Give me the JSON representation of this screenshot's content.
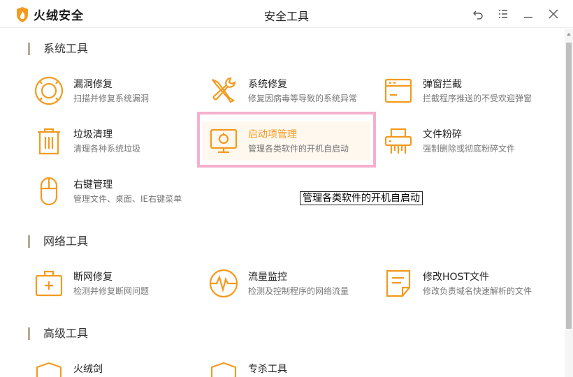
{
  "app": {
    "brand": "火绒安全",
    "window_title": "安全工具"
  },
  "sections": [
    {
      "title": "系统工具",
      "tools": [
        {
          "name": "漏洞修复",
          "desc": "扫描并修复系统漏洞",
          "icon": "lifebuoy-icon"
        },
        {
          "name": "系统修复",
          "desc": "修复因病毒等导致的系统异常",
          "icon": "wrench-screwdriver-icon"
        },
        {
          "name": "弹窗拦截",
          "desc": "拦截程序推送的不受欢迎弹窗",
          "icon": "popup-window-icon"
        },
        {
          "name": "垃圾清理",
          "desc": "清理各种系统垃圾",
          "icon": "trash-icon"
        },
        {
          "name": "启动项管理",
          "desc": "管理各类软件的开机自启动",
          "icon": "startup-monitor-icon"
        },
        {
          "name": "文件粉碎",
          "desc": "强制删除或彻底粉碎文件",
          "icon": "shredder-icon"
        },
        {
          "name": "右键管理",
          "desc": "管理文件、桌面、IE右键菜单",
          "icon": "mouse-icon"
        }
      ]
    },
    {
      "title": "网络工具",
      "tools": [
        {
          "name": "断网修复",
          "desc": "检测并修复断网问题",
          "icon": "medkit-icon"
        },
        {
          "name": "流量监控",
          "desc": "检测及控制程序的网络流量",
          "icon": "pulse-monitor-icon"
        },
        {
          "name": "修改HOST文件",
          "desc": "修改负责域名快速解析的文件",
          "icon": "document-edit-icon"
        }
      ]
    },
    {
      "title": "高级工具",
      "tools": [
        {
          "name": "火绒剑",
          "desc": "",
          "icon": "shield-icon"
        },
        {
          "name": "专杀工具",
          "desc": "",
          "icon": "shield-icon"
        }
      ]
    }
  ],
  "tooltip": "管理各类软件的开机自启动",
  "colors": {
    "accent": "#f39a1f",
    "highlight_border": "#f4b0cd",
    "section_marker": "#b8aa98"
  }
}
